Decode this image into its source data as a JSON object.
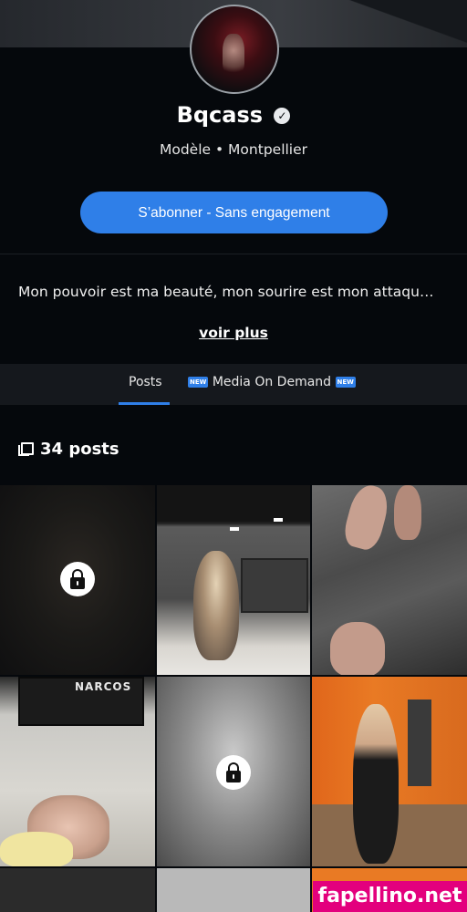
{
  "profile": {
    "name": "Bqcass",
    "verified_icon": "verified-check-icon",
    "subtitle": "Modèle • Montpellier",
    "subscribe_label": "S’abonner - Sans engagement",
    "bio": "Mon pouvoir est ma beauté, mon sourire est mon attaqu…",
    "see_more_label": "voir plus"
  },
  "tabs": [
    {
      "label": "Posts",
      "active": true
    },
    {
      "label": "Media On Demand",
      "badge": "NEW"
    }
  ],
  "posts": {
    "count_label": "34 posts",
    "icon": "posts-stack-icon"
  },
  "grid": {
    "tiles": [
      {
        "locked": true
      },
      {
        "locked": false
      },
      {
        "locked": false
      },
      {
        "locked": false,
        "tv_text": "NARCOS"
      },
      {
        "locked": true
      },
      {
        "locked": false
      }
    ]
  },
  "watermark": "fapellino.net",
  "colors": {
    "accent": "#2f7fe8",
    "background": "#05080c",
    "watermark": "#e3007d"
  }
}
